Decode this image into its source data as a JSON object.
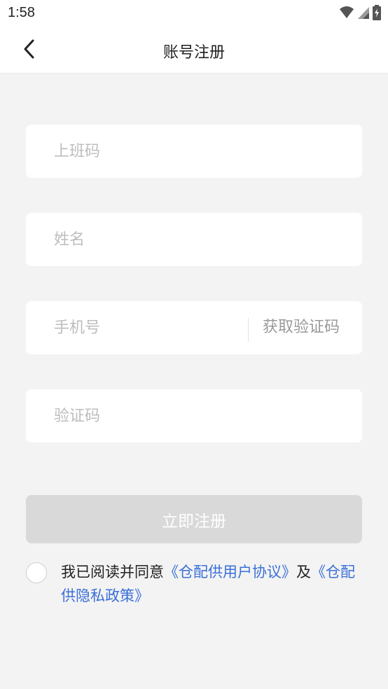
{
  "status_bar": {
    "time": "1:58",
    "icons": [
      "wifi-icon",
      "signal-icon",
      "battery-charging-icon"
    ]
  },
  "header": {
    "back_icon": "chevron-left-icon",
    "title": "账号注册"
  },
  "form": {
    "work_code": {
      "placeholder": "上班码",
      "value": ""
    },
    "name": {
      "placeholder": "姓名",
      "value": ""
    },
    "phone": {
      "placeholder": "手机号",
      "value": ""
    },
    "get_code_label": "获取验证码",
    "verify_code": {
      "placeholder": "验证码",
      "value": ""
    },
    "submit_label": "立即注册"
  },
  "agreement": {
    "checked": false,
    "prefix": "我已阅读并同意",
    "user_agreement": "《仓配供用户协议》",
    "conjunction": "及",
    "privacy_policy": "《仓配供隐私政策》"
  },
  "colors": {
    "background": "#f3f3f3",
    "link": "#3a6fd8",
    "button_disabled": "#d9d9d9",
    "placeholder": "#bdbdbd"
  }
}
